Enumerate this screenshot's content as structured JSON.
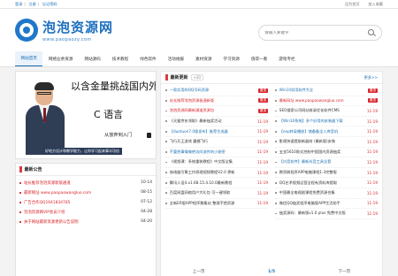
{
  "topbar": {
    "links": [
      "登录",
      "注册",
      "忘记密码"
    ],
    "right": [
      "设为首页",
      "加入收藏"
    ]
  },
  "logo": {
    "title": "泡泡资源网",
    "url": "www.paopaozy.com"
  },
  "search": {
    "placeholder": "请输入关键字"
  },
  "nav": [
    "网站首页",
    "网络业余资源",
    "网站源码",
    "技术教程",
    "绿色软件",
    "活动线报",
    "素材资源",
    "学习资源",
    "值得一看",
    "游戏专栏"
  ],
  "banner": {
    "line1": "以含金量挑战国内外",
    "line2": "C 语言",
    "line3": "从放弃到入门",
    "caption": "好地方设计和教学能力，让你学习起来事半功倍"
  },
  "notice": {
    "title": "最新公告",
    "items": [
      {
        "text": "站长推荐泡泡资源新版通道",
        "date": "10-14"
      },
      {
        "text": "最新网址 www.paopaowangluo.com",
        "date": "08-15"
      },
      {
        "text": "广告合作QQ1641834785",
        "date": "07-12"
      },
      {
        "text": "泡泡资源网VIP会员介绍",
        "date": "04-28"
      },
      {
        "text": "关于网站最新资源更新公告说明",
        "date": "04-20"
      }
    ]
  },
  "latest": {
    "title": "最新更新",
    "count": "+30",
    "more": "更多>>",
    "left": [
      {
        "text": "一款实用的QQ号码资源",
        "style": "blue",
        "badge": "置顶"
      },
      {
        "text": "站长推荐泡泡资源极速新版",
        "style": "red",
        "badge": "置顶"
      },
      {
        "text": "泡泡资源网最新通道资源包",
        "style": "red",
        "badge": "置顶"
      },
      {
        "text": "《天猫京东领取》最新抽奖活动",
        "style": "",
        "date": "11-19"
      },
      {
        "text": "【duotuon7.0版发布】推荐生成器",
        "style": "blue",
        "date": "11-19"
      },
      {
        "text": "飞行兵王游戏 震撼飞行",
        "style": "",
        "date": "11-19"
      },
      {
        "text": "不要把事情做绝坊间流传的小秘密",
        "style": "blue",
        "date": "11-19"
      },
      {
        "text": "《视频课：系统重装教程》中文版全集",
        "style": "",
        "date": "11-19"
      },
      {
        "text": "修改器引擎工作原理视频教程V2.0 更新",
        "style": "",
        "date": "11-19"
      },
      {
        "text": "腾讯人设4.x1.68.15.4.10.0最新教程",
        "style": "",
        "date": "11-19"
      },
      {
        "text": "百度网盘网络用户大礼包 可一键领取",
        "style": "",
        "date": "11-19"
      },
      {
        "text": "全新ER版APP程序聚集站 整理不错资源",
        "style": "",
        "date": "11-19"
      }
    ],
    "right": [
      {
        "text": "Win10实用软件大全",
        "style": "blue",
        "badge": "置顶"
      },
      {
        "text": "最新网址 www.paopaowangluo.com",
        "style": "red",
        "badge": "置顶"
      },
      {
        "text": "SEO搜索公司网站收录优化软件CMS",
        "style": "",
        "date": "11-19"
      },
      {
        "text": "【Win10系统】多个好用的安装器下载",
        "style": "blue",
        "date": "11-19"
      },
      {
        "text": "【exp转录播放】储备备全入库音机",
        "style": "blue",
        "date": "11-19"
      },
      {
        "text": "影视快速提取新器材 (最新版)安装",
        "style": "",
        "date": "11-19"
      },
      {
        "text": "五金5610款式控制中国国内资源抽奖",
        "style": "",
        "date": "11-19"
      },
      {
        "text": "【抖音软件】最新抖音工具全套",
        "style": "blue",
        "date": "11-19"
      },
      {
        "text": "教资刷程序APP电脑课程1-3完整版",
        "style": "",
        "date": "11-19"
      },
      {
        "text": "QQ艺术视频运营全程有资料库提取",
        "style": "",
        "date": "11-19"
      },
      {
        "text": "中国最全电视剧课程免费资源合集",
        "style": "",
        "date": "11-19"
      },
      {
        "text": "微信QQ抽奖程序电脑版APP生活助手",
        "style": "",
        "date": "11-19"
      },
      {
        "text": "抽奖源码：最新版v1.0 plus 免费中文版",
        "style": "",
        "date": "11-19"
      }
    ],
    "pager": {
      "prev": "上一页",
      "mid": "1/5",
      "next": "下一页"
    }
  }
}
